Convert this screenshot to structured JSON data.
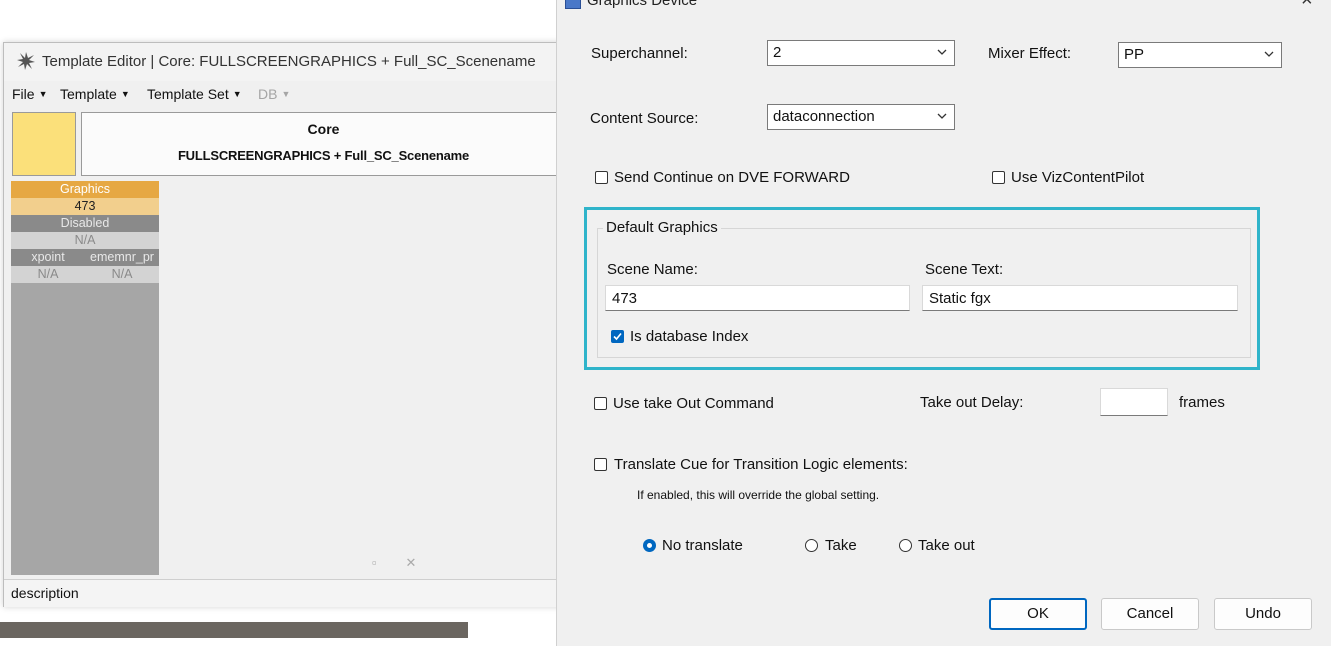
{
  "template_editor": {
    "title": "Template Editor | Core: FULLSCREENGRAPHICS + Full_SC_Scenename",
    "menu": [
      "File",
      "Template",
      "Template Set",
      "DB"
    ],
    "header": {
      "category": "Core",
      "name": "FULLSCREENGRAPHICS + Full_SC_Scenename",
      "swatch_color": "#fbe07a"
    },
    "column": {
      "graphics_label": "Graphics",
      "graphics_value": "473",
      "disabled_label": "Disabled",
      "disabled_value": "N/A",
      "col1_label": "xpoint",
      "col2_label": "ememnr_pr",
      "col1_value": "N/A",
      "col2_value": "N/A"
    },
    "status_label": "description"
  },
  "dialog": {
    "title": "Graphics Device",
    "close_glyph": "×",
    "superchannel": {
      "label": "Superchannel:",
      "value": "2"
    },
    "mixer_effect": {
      "label": "Mixer Effect:",
      "value": "PP"
    },
    "content_source": {
      "label": "Content Source:",
      "value": "dataconnection"
    },
    "send_continue": {
      "label": "Send Continue on DVE FORWARD",
      "checked": false
    },
    "use_vizcontentpilot": {
      "label": "Use VizContentPilot",
      "checked": false
    },
    "default_graphics": {
      "legend": "Default Graphics",
      "scene_name_label": "Scene Name:",
      "scene_name_value": "473",
      "scene_text_label": "Scene Text:",
      "scene_text_value": "Static fgx",
      "is_db_index_label": "Is database Index",
      "is_db_index_checked": true,
      "highlight_color": "#2fb4ca"
    },
    "take_out": {
      "checkbox_label": "Use take Out Command",
      "checked": false,
      "delay_label": "Take out Delay:",
      "delay_value": "",
      "unit": "frames"
    },
    "translate_cue": {
      "checkbox_label": "Translate Cue for Transition Logic elements:",
      "checked": false,
      "hint": "If enabled, this will override the global setting.",
      "options": [
        "No translate",
        "Take",
        "Take out"
      ],
      "selected": "No translate"
    },
    "buttons": {
      "ok": "OK",
      "cancel": "Cancel",
      "undo": "Undo"
    },
    "accent_color": "#0067c0"
  }
}
